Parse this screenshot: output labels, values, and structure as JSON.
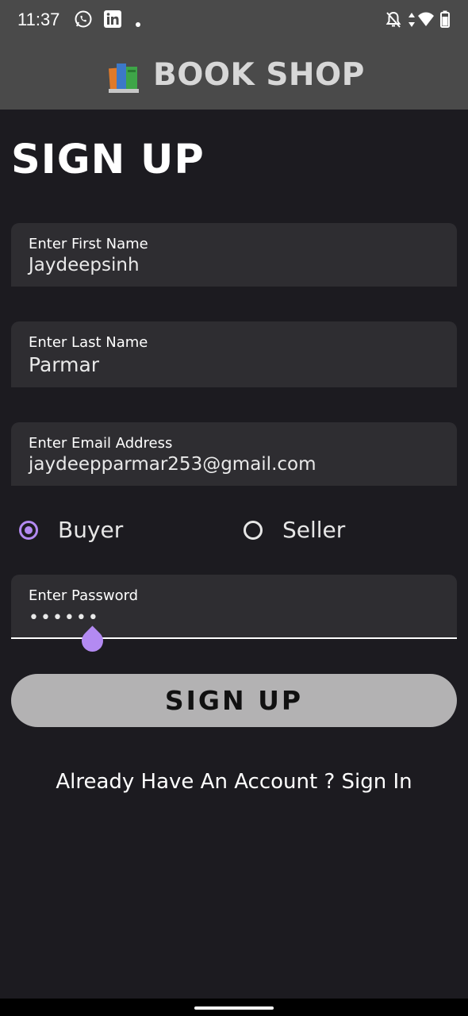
{
  "status_bar": {
    "time": "11:37",
    "left_icons": [
      "whatsapp-icon",
      "linkedin-icon",
      "dot-icon"
    ],
    "right_icons": [
      "notifications-off-icon",
      "data-arrows-icon",
      "wifi-icon",
      "battery-icon"
    ]
  },
  "app_bar": {
    "logo_icon": "books-icon",
    "title": "BOOK SHOP"
  },
  "page_title": "SIGN UP",
  "form": {
    "first_name": {
      "label": "Enter First Name",
      "value": "Jaydeepsinh"
    },
    "last_name": {
      "label": "Enter Last Name",
      "value": "Parmar"
    },
    "email": {
      "label": "Enter Email Address",
      "value": "jaydeepparmar253@gmail.com"
    },
    "role": {
      "options": [
        {
          "label": "Buyer",
          "selected": true
        },
        {
          "label": "Seller",
          "selected": false
        }
      ]
    },
    "password": {
      "label": "Enter Password",
      "value": "••••••"
    },
    "submit_label": "SIGN UP"
  },
  "signin_link": "Already Have An Account ? Sign In",
  "colors": {
    "background": "#1c1b20",
    "app_bar": "#4a4a4a",
    "field_bg": "#2e2d31",
    "accent": "#b38af2",
    "button_bg": "#b3b2b3"
  }
}
